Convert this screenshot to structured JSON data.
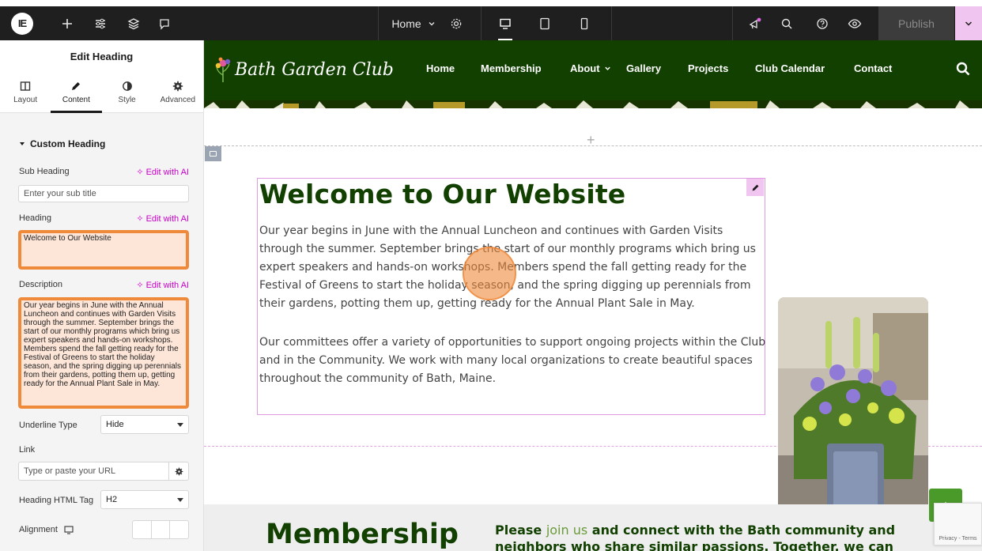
{
  "topbar": {
    "logo_text": "IE",
    "page_name": "Home",
    "publish_label": "Publish"
  },
  "panel": {
    "title": "Edit Heading",
    "tabs": [
      {
        "label": "Layout",
        "icon": "columns-icon"
      },
      {
        "label": "Content",
        "icon": "pencil-icon",
        "active": true
      },
      {
        "label": "Style",
        "icon": "contrast-icon"
      },
      {
        "label": "Advanced",
        "icon": "gear-icon"
      }
    ],
    "section_title": "Custom Heading",
    "ai_link": "Edit with AI",
    "sub_heading_label": "Sub Heading",
    "sub_heading_placeholder": "Enter your sub title",
    "heading_label": "Heading",
    "heading_value": "Welcome to Our Website",
    "description_label": "Description",
    "description_value": "Our year begins in June with the Annual Luncheon and continues with Garden Visits through the summer. September brings the start of our monthly programs which bring us expert speakers and hands-on workshops. Members spend the fall getting ready for the Festival of Greens to start the holiday season, and the spring digging up perennials from their gardens, potting them up, getting ready for the Annual Plant Sale in May.",
    "underline_label": "Underline Type",
    "underline_value": "Hide",
    "link_label": "Link",
    "link_placeholder": "Type or paste your URL",
    "html_tag_label": "Heading HTML Tag",
    "html_tag_value": "H2",
    "alignment_label": "Alignment"
  },
  "site": {
    "logo_text": "Bath Garden Club",
    "nav": [
      "Home",
      "Membership",
      "About",
      "Gallery",
      "Projects",
      "Club Calendar",
      "Contact"
    ],
    "welcome_title": "Welcome to Our Website",
    "welcome_p1": "Our year begins in June with the Annual Luncheon and continues with Garden Visits through the summer. September brings the start of our monthly programs which bring us expert speakers and hands-on workshops. Members spend the fall getting ready for the Festival of Greens to start the holiday season, and the spring digging up perennials from their gardens, potting them up, getting ready for the Annual Plant Sale in May.",
    "welcome_p2": "Our committees offer a variety of opportunities to support ongoing projects within the Club and in the Community. We work with many local organizations to create beautiful spaces throughout the community of Bath, Maine.",
    "membership_title": "Membership",
    "membership_pre": "Please ",
    "membership_link": "join us",
    "membership_post": " and connect with the Bath community and neighbors who share similar passions. Together, we can preserve",
    "recaptcha_text": "Privacy - Terms"
  },
  "colors": {
    "brand_green": "#114000",
    "highlight_orange": "#ef8a3a",
    "ai_magenta": "#c800c8"
  }
}
